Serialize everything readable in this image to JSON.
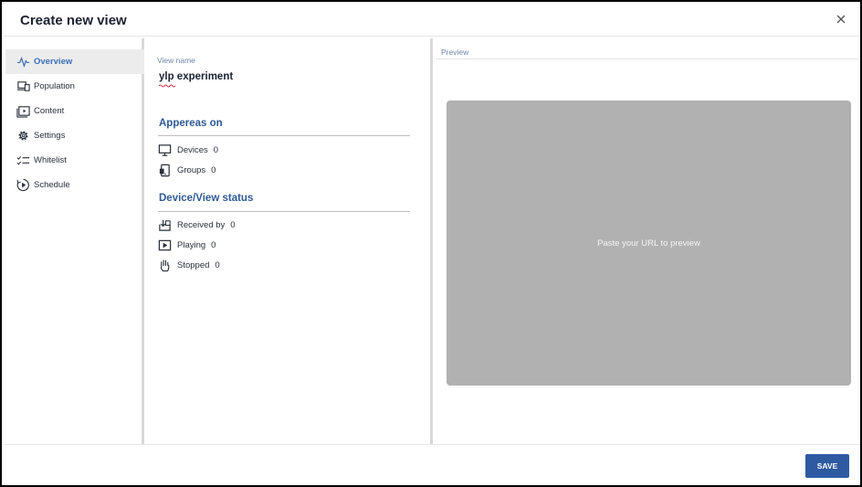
{
  "dialog": {
    "title": "Create new view",
    "close_icon": "close-icon"
  },
  "sidebar": {
    "items": [
      {
        "label": "Overview",
        "icon": "pulse-icon",
        "active": true
      },
      {
        "label": "Population",
        "icon": "devices-icon",
        "active": false
      },
      {
        "label": "Content",
        "icon": "media-folder-icon",
        "active": false
      },
      {
        "label": "Settings",
        "icon": "gear-icon",
        "active": false
      },
      {
        "label": "Whitelist",
        "icon": "checklist-icon",
        "active": false
      },
      {
        "label": "Schedule",
        "icon": "schedule-play-icon",
        "active": false
      }
    ]
  },
  "overview": {
    "view_name_label": "View name",
    "view_name_value": "ylp experiment",
    "appears_on": {
      "title": "Appereas on",
      "stats": [
        {
          "label": "Devices",
          "value": "0",
          "icon": "monitor-icon"
        },
        {
          "label": "Groups",
          "value": "0",
          "icon": "device-group-icon"
        }
      ]
    },
    "status": {
      "title": "Device/View status",
      "stats": [
        {
          "label": "Received by",
          "value": "0",
          "icon": "download-tray-icon"
        },
        {
          "label": "Playing",
          "value": "0",
          "icon": "play-icon"
        },
        {
          "label": "Stopped",
          "value": "0",
          "icon": "hand-stop-icon"
        }
      ]
    }
  },
  "preview": {
    "label": "Preview",
    "placeholder": "Paste your URL to preview"
  },
  "footer": {
    "save_label": "SAVE"
  },
  "colors": {
    "accent": "#2e5aa1",
    "section_title": "#2f5a96",
    "active_nav": "#3a6fb7",
    "preview_bg": "#b1b1b1"
  }
}
